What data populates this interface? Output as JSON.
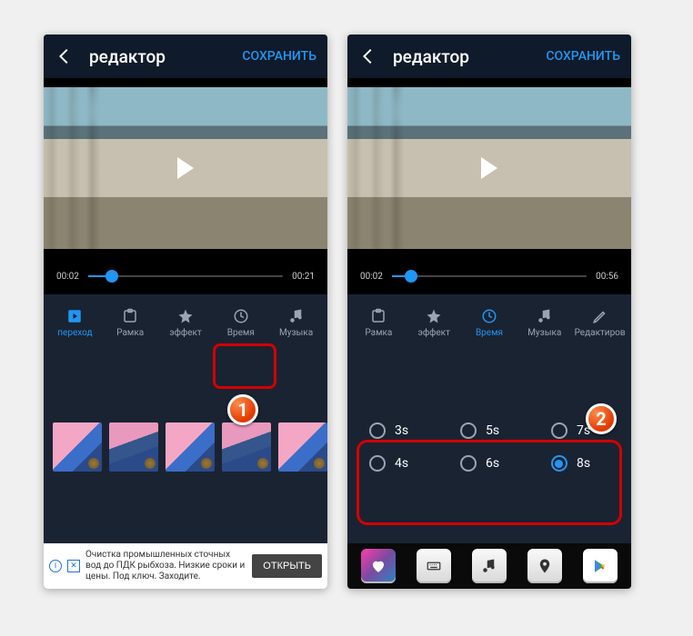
{
  "left": {
    "header": {
      "title": "редактор",
      "save_label": "СОХРАНИТЬ"
    },
    "timeline": {
      "start": "00:02",
      "end": "00:21",
      "progress_pct": 12
    },
    "tabs": [
      {
        "id": "transition",
        "label": "переход",
        "icon": "play-sq",
        "active": true
      },
      {
        "id": "frame",
        "label": "Рамка",
        "icon": "frame"
      },
      {
        "id": "effect",
        "label": "эффект",
        "icon": "star"
      },
      {
        "id": "time",
        "label": "Время",
        "icon": "clock"
      },
      {
        "id": "music",
        "label": "Музыка",
        "icon": "note"
      }
    ],
    "ad": {
      "text": "Очистка промышленных сточных вод до ПДК рыбхоза. Низкие сроки и цены. Под ключ. Заходите.",
      "cta": "ОТКРЫТЬ"
    },
    "annotation": {
      "badge": "1"
    }
  },
  "right": {
    "header": {
      "title": "редактор",
      "save_label": "СОХРАНИТЬ"
    },
    "timeline": {
      "start": "00:02",
      "end": "00:56",
      "progress_pct": 10
    },
    "tabs": [
      {
        "id": "frame",
        "label": "Рамка",
        "icon": "frame"
      },
      {
        "id": "effect",
        "label": "эффект",
        "icon": "star"
      },
      {
        "id": "time",
        "label": "Время",
        "icon": "clock",
        "active": true
      },
      {
        "id": "music",
        "label": "Музыка",
        "icon": "note"
      },
      {
        "id": "edit",
        "label": "Редактиров",
        "icon": "pencil"
      }
    ],
    "time_options": [
      {
        "label": "3s",
        "selected": false
      },
      {
        "label": "5s",
        "selected": false
      },
      {
        "label": "7s",
        "selected": false
      },
      {
        "label": "4s",
        "selected": false
      },
      {
        "label": "6s",
        "selected": false
      },
      {
        "label": "8s",
        "selected": true
      }
    ],
    "annotation": {
      "badge": "2"
    }
  },
  "colors": {
    "accent": "#2196f3",
    "panel": "#1a2332",
    "highlight": "#d40000"
  }
}
